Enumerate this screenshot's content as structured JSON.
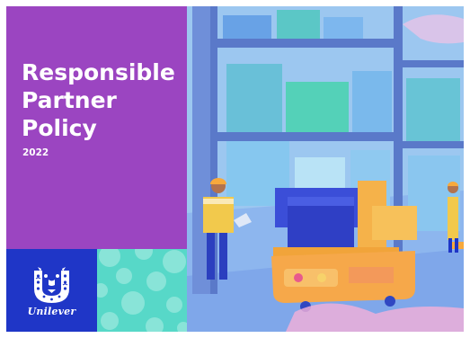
{
  "cover": {
    "title_lines": [
      "Responsible",
      "Partner",
      "Policy"
    ],
    "year": "2022",
    "brand": "Unilever"
  },
  "colors": {
    "purple": "#9b45c1",
    "brand_blue": "#1f36c7",
    "teal": "#57d8c8"
  },
  "icons": {
    "logo": "unilever-u-logo-icon",
    "dots": "circle-pattern"
  }
}
